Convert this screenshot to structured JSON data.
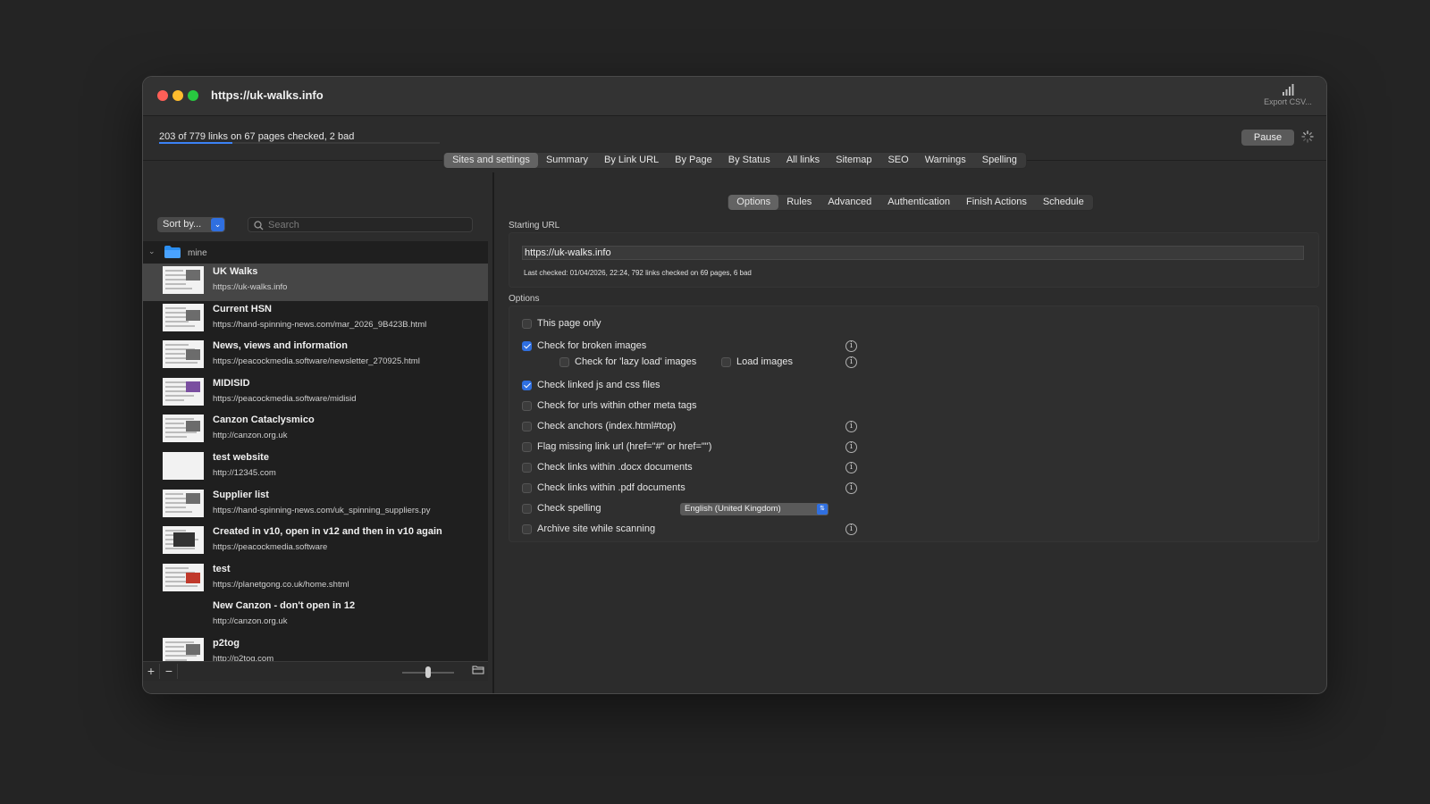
{
  "window": {
    "title": "https://uk-walks.info",
    "export_label": "Export CSV...",
    "progress_text": "203 of 779 links on 67 pages checked, 2 bad",
    "progress_fraction": 0.26,
    "pause_label": "Pause"
  },
  "main_tabs": [
    {
      "label": "Sites and settings",
      "active": true
    },
    {
      "label": "Summary"
    },
    {
      "label": "By Link URL"
    },
    {
      "label": "By Page"
    },
    {
      "label": "By Status"
    },
    {
      "label": "All links"
    },
    {
      "label": "Sitemap"
    },
    {
      "label": "SEO"
    },
    {
      "label": "Warnings"
    },
    {
      "label": "Spelling"
    }
  ],
  "sidebar": {
    "sort_label": "Sort by...",
    "search_placeholder": "Search",
    "group_label": "mine",
    "sites": [
      {
        "name": "UK Walks",
        "url": "https://uk-walks.info",
        "selected": true
      },
      {
        "name": "Current HSN",
        "url": "https://hand-spinning-news.com/mar_2026_9B423B.html"
      },
      {
        "name": "News, views and information",
        "url": "https://peacockmedia.software/newsletter_270925.html"
      },
      {
        "name": "MIDISID",
        "url": "https://peacockmedia.software/midisid"
      },
      {
        "name": "Canzon Cataclysmico",
        "url": "http://canzon.org.uk"
      },
      {
        "name": "test website",
        "url": "http://12345.com"
      },
      {
        "name": "Supplier list",
        "url": "https://hand-spinning-news.com/uk_spinning_suppliers.py"
      },
      {
        "name": "Created in v10, open in v12 and then in v10 again",
        "url": "https://peacockmedia.software"
      },
      {
        "name": "test",
        "url": "https://planetgong.co.uk/home.shtml"
      },
      {
        "name": "New Canzon - don't open in 12",
        "url": "http://canzon.org.uk"
      },
      {
        "name": "p2tog",
        "url": "http://p2tog.com"
      }
    ],
    "add_label": "+",
    "remove_label": "−",
    "thumb_size_fraction": 0.5
  },
  "sub_tabs": [
    {
      "label": "Options",
      "active": true
    },
    {
      "label": "Rules"
    },
    {
      "label": "Advanced"
    },
    {
      "label": "Authentication"
    },
    {
      "label": "Finish Actions"
    },
    {
      "label": "Schedule"
    }
  ],
  "starting_url": {
    "section_label": "Starting URL",
    "value": "https://uk-walks.info",
    "last_checked": "Last checked: 01/04/2026, 22:24, 792 links checked on 69 pages, 6 bad"
  },
  "options": {
    "section_label": "Options",
    "items": [
      {
        "label": "This page only",
        "checked": false
      },
      {
        "label": "Check for broken images",
        "checked": true
      },
      {
        "label": "Check for 'lazy load' images",
        "checked": false
      },
      {
        "label": "Load images",
        "checked": false
      },
      {
        "label": "Check linked js and css files",
        "checked": true
      },
      {
        "label": "Check for urls within other meta tags",
        "checked": false
      },
      {
        "label": "Check anchors (index.html#top)",
        "checked": false
      },
      {
        "label": "Flag missing link url (href=\"#\" or href=\"\")",
        "checked": false
      },
      {
        "label": "Check links within .docx documents",
        "checked": false
      },
      {
        "label": "Check links within .pdf documents",
        "checked": false
      },
      {
        "label": "Check spelling",
        "checked": false
      },
      {
        "label": "Archive site while scanning",
        "checked": false
      }
    ],
    "spelling_language": "English (United Kingdom)"
  },
  "colors": {
    "accent": "#2f6fe0",
    "progress": "#3b82f6"
  }
}
